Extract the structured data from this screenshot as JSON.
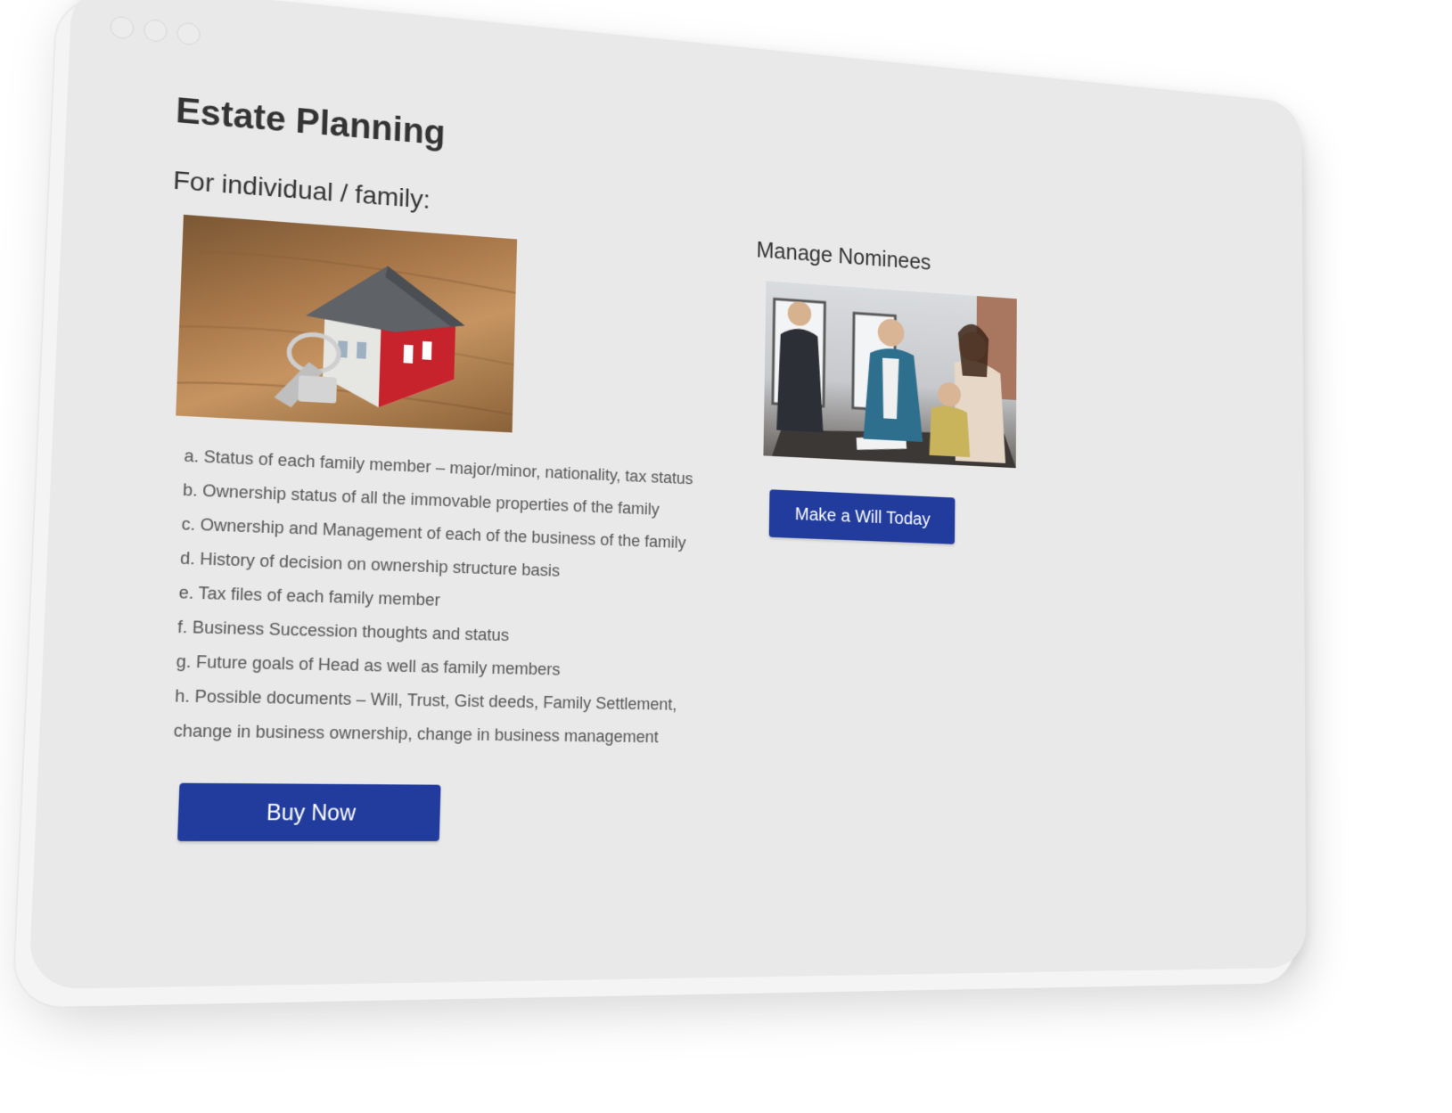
{
  "page": {
    "title": "Estate Planning"
  },
  "individual": {
    "heading": "For individual / family:",
    "items": [
      "a. Status of each family member – major/minor, nationality, tax status",
      "b. Ownership status of all the immovable properties of the family",
      "c. Ownership and Management of each of the business of the family",
      "d. History of decision on ownership structure basis",
      "e. Tax files of each family member",
      "f. Business Succession thoughts and status",
      "g. Future goals of Head as well as family members",
      "h. Possible documents – Will, Trust, Gist deeds, Family Settlement,",
      "change in business ownership, change in business management"
    ],
    "button_label": "Buy Now"
  },
  "nominees": {
    "heading": "Manage Nominees",
    "button_label": "Make a Will Today"
  },
  "colors": {
    "button": "#213c9c",
    "background": "#e9e9e9",
    "text": "#333333"
  }
}
